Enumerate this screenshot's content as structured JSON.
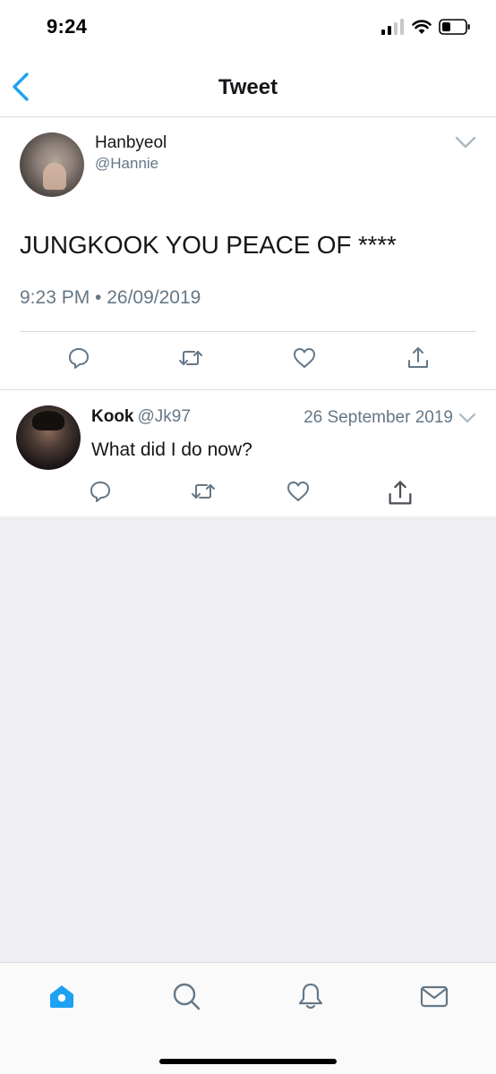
{
  "status_bar": {
    "time": "9:24",
    "icons": [
      "signal-icon",
      "wifi-icon",
      "battery-icon"
    ]
  },
  "nav": {
    "title": "Tweet",
    "back_icon": "chevron-left-icon"
  },
  "main_tweet": {
    "name": "Hanbyeol",
    "handle": "@Hannie",
    "text": "JUNGKOOK YOU PEACE OF ****",
    "timestamp": "9:23 PM • 26/09/2019",
    "actions": [
      "reply-icon",
      "retweet-icon",
      "like-icon",
      "share-icon"
    ]
  },
  "reply": {
    "name": "Kook",
    "handle": "@Jk97",
    "date": "26 September 2019",
    "text": "What did I do now?",
    "actions": [
      "reply-icon",
      "retweet-icon",
      "like-icon",
      "share-icon"
    ]
  },
  "tab_bar": {
    "tabs": [
      "home-icon",
      "search-icon",
      "notifications-icon",
      "messages-icon"
    ],
    "active": "home-icon"
  },
  "colors": {
    "accent": "#1da1f2",
    "icon_gray": "#657786",
    "text": "#14171a",
    "background_empty": "#efeff3"
  }
}
